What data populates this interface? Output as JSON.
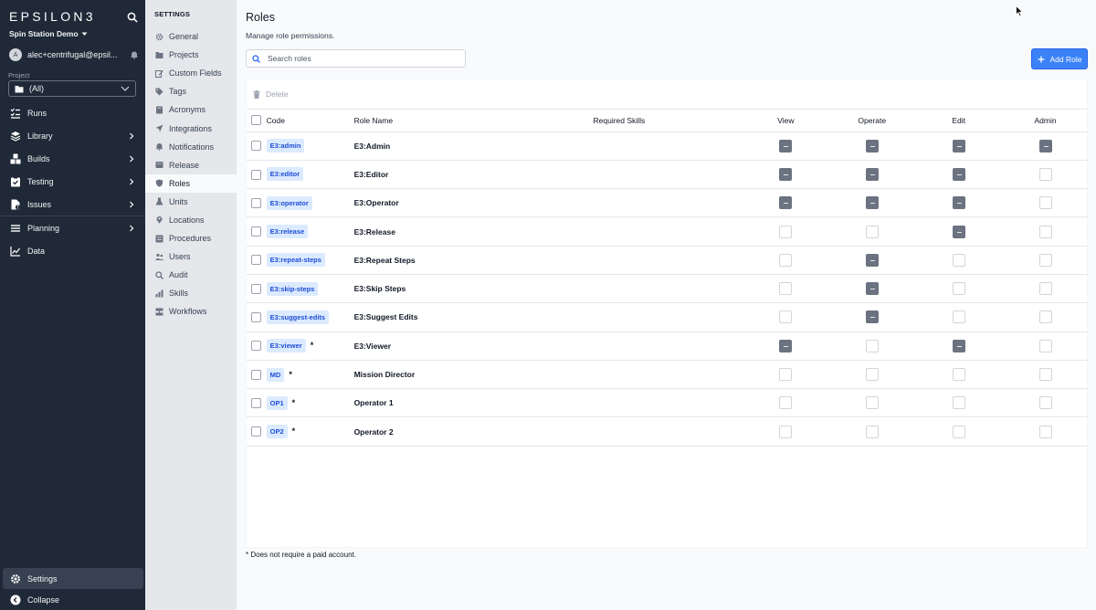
{
  "brand": {
    "logo": "EPSILON3",
    "workspace": "Spin Station Demo"
  },
  "user": {
    "initial": "A",
    "email": "alec+centrifugal@epsil..."
  },
  "project": {
    "label": "Project",
    "value": "(All)"
  },
  "nav": {
    "items": [
      {
        "label": "Runs",
        "icon": "runs-icon",
        "chevron": false
      },
      {
        "label": "Library",
        "icon": "library-icon",
        "chevron": true
      },
      {
        "label": "Builds",
        "icon": "builds-icon",
        "chevron": true
      },
      {
        "label": "Testing",
        "icon": "testing-icon",
        "chevron": true
      },
      {
        "label": "Issues",
        "icon": "issues-icon",
        "chevron": true
      },
      {
        "label": "Planning",
        "icon": "planning-icon",
        "chevron": true
      },
      {
        "label": "Data",
        "icon": "data-icon",
        "chevron": false
      }
    ],
    "settings_label": "Settings",
    "collapse_label": "Collapse"
  },
  "settings_nav": {
    "title": "SETTINGS",
    "items": [
      {
        "label": "General",
        "icon": "gear-icon",
        "active": false
      },
      {
        "label": "Projects",
        "icon": "folder-icon",
        "active": false
      },
      {
        "label": "Custom Fields",
        "icon": "edit-icon",
        "active": false
      },
      {
        "label": "Tags",
        "icon": "tag-icon",
        "active": false
      },
      {
        "label": "Acronyms",
        "icon": "book-icon",
        "active": false
      },
      {
        "label": "Integrations",
        "icon": "send-icon",
        "active": false
      },
      {
        "label": "Notifications",
        "icon": "bell-icon",
        "active": false
      },
      {
        "label": "Release",
        "icon": "release-icon",
        "active": false
      },
      {
        "label": "Roles",
        "icon": "shield-icon",
        "active": true
      },
      {
        "label": "Units",
        "icon": "flask-icon",
        "active": false
      },
      {
        "label": "Locations",
        "icon": "pin-icon",
        "active": false
      },
      {
        "label": "Procedures",
        "icon": "procedures-icon",
        "active": false
      },
      {
        "label": "Users",
        "icon": "users-icon",
        "active": false
      },
      {
        "label": "Audit",
        "icon": "audit-icon",
        "active": false
      },
      {
        "label": "Skills",
        "icon": "skills-icon",
        "active": false
      },
      {
        "label": "Workflows",
        "icon": "workflows-icon",
        "active": false
      }
    ]
  },
  "page": {
    "title": "Roles",
    "subtitle": "Manage role permissions.",
    "search_placeholder": "Search roles",
    "add_button": "Add Role",
    "delete_button": "Delete",
    "footnote": "* Does not require a paid account."
  },
  "table": {
    "columns": [
      "Code",
      "Role Name",
      "Required Skills",
      "View",
      "Operate",
      "Edit",
      "Admin"
    ],
    "rows": [
      {
        "code": "E3:admin",
        "name": "E3:Admin",
        "star": "",
        "skills": "",
        "view": true,
        "operate": true,
        "edit": true,
        "admin": true
      },
      {
        "code": "E3:editor",
        "name": "E3:Editor",
        "star": "",
        "skills": "",
        "view": true,
        "operate": true,
        "edit": true,
        "admin": false
      },
      {
        "code": "E3:operator",
        "name": "E3:Operator",
        "star": "",
        "skills": "",
        "view": true,
        "operate": true,
        "edit": true,
        "admin": false
      },
      {
        "code": "E3:release",
        "name": "E3:Release",
        "star": "",
        "skills": "",
        "view": false,
        "operate": false,
        "edit": true,
        "admin": false
      },
      {
        "code": "E3:repeat-steps",
        "name": "E3:Repeat Steps",
        "star": "",
        "skills": "",
        "view": false,
        "operate": true,
        "edit": false,
        "admin": false
      },
      {
        "code": "E3:skip-steps",
        "name": "E3:Skip Steps",
        "star": "",
        "skills": "",
        "view": false,
        "operate": true,
        "edit": false,
        "admin": false
      },
      {
        "code": "E3:suggest-edits",
        "name": "E3:Suggest Edits",
        "star": "",
        "skills": "",
        "view": false,
        "operate": true,
        "edit": false,
        "admin": false
      },
      {
        "code": "E3:viewer",
        "name": "E3:Viewer",
        "star": "*",
        "skills": "",
        "view": true,
        "operate": false,
        "edit": true,
        "admin": false
      },
      {
        "code": "MD",
        "name": "Mission Director",
        "star": "*",
        "skills": "",
        "view": false,
        "operate": false,
        "edit": false,
        "admin": false
      },
      {
        "code": "OP1",
        "name": "Operator 1",
        "star": "*",
        "skills": "",
        "view": false,
        "operate": false,
        "edit": false,
        "admin": false
      },
      {
        "code": "OP2",
        "name": "Operator 2",
        "star": "*",
        "skills": "",
        "view": false,
        "operate": false,
        "edit": false,
        "admin": false
      }
    ]
  },
  "colors": {
    "sidebar": "#1f2937",
    "accent": "#3b82f6",
    "badge_bg": "#dbeafe",
    "badge_text": "#1d4ed8",
    "checked": "#6b7280"
  }
}
